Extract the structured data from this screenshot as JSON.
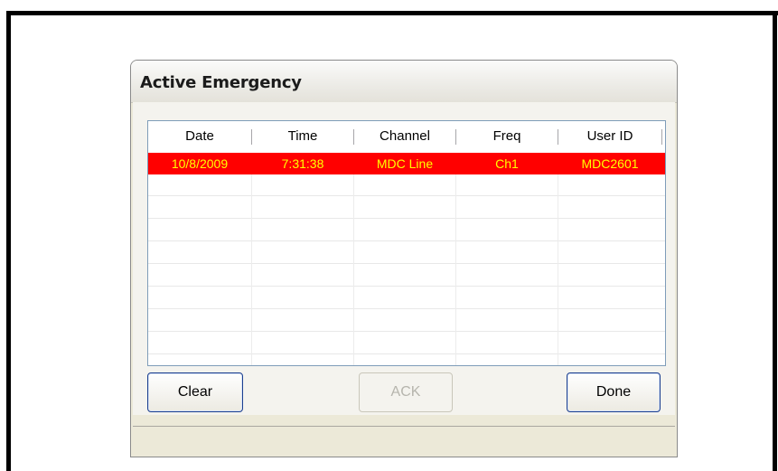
{
  "window": {
    "title": "Active Emergency"
  },
  "grid": {
    "columns": [
      "Date",
      "Time",
      "Channel",
      "Freq",
      "User ID"
    ],
    "rows": [
      [
        "10/8/2009",
        "7:31:38",
        "MDC Line",
        "Ch1",
        "MDC2601"
      ]
    ],
    "highlight_color": "#ff0000",
    "highlight_text_color": "#ffff00"
  },
  "buttons": {
    "clear": "Clear",
    "ack": "ACK",
    "done": "Done"
  }
}
